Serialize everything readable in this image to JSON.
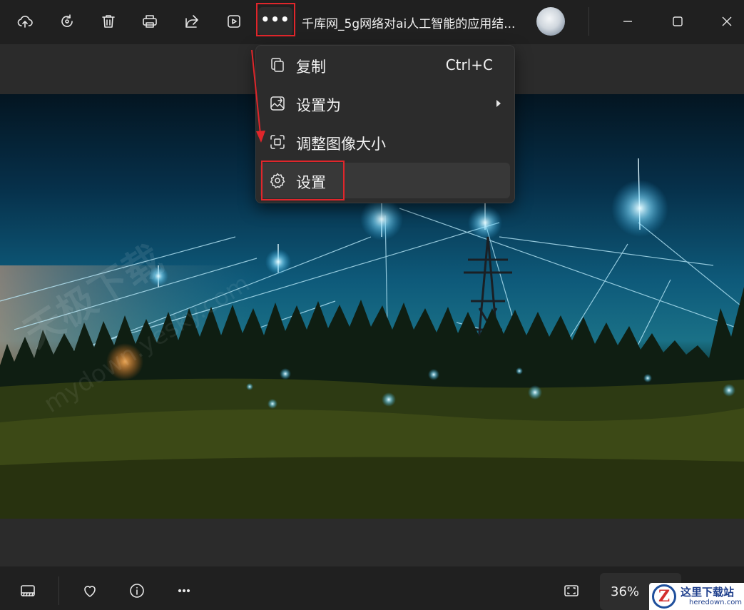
{
  "toolbar": {
    "title": "千库网_5g网络对ai人工智能的应用结...",
    "more_label": "•••",
    "icons": [
      "upload-cloud-icon",
      "rotate-icon",
      "trash-icon",
      "print-icon",
      "share-icon",
      "slideshow-icon",
      "more-icon"
    ]
  },
  "menu": {
    "items": [
      {
        "label": "复制",
        "shortcut": "Ctrl+C",
        "icon": "copy-icon"
      },
      {
        "label": "设置为",
        "icon": "set-as-icon",
        "has_submenu": true
      },
      {
        "label": "调整图像大小",
        "icon": "resize-icon"
      },
      {
        "label": "设置",
        "icon": "gear-icon",
        "highlighted": true
      }
    ]
  },
  "statusbar": {
    "zoom": "36%"
  },
  "brand": {
    "logo_letter": "Z",
    "name": "这里下载站",
    "url": "heredown.com"
  },
  "watermark": {
    "text": "天极下载",
    "subtext": "mydown.yesky.com"
  },
  "colors": {
    "highlight": "#e0262b",
    "menu_bg": "#2c2c2c",
    "toolbar_bg": "#202020"
  }
}
